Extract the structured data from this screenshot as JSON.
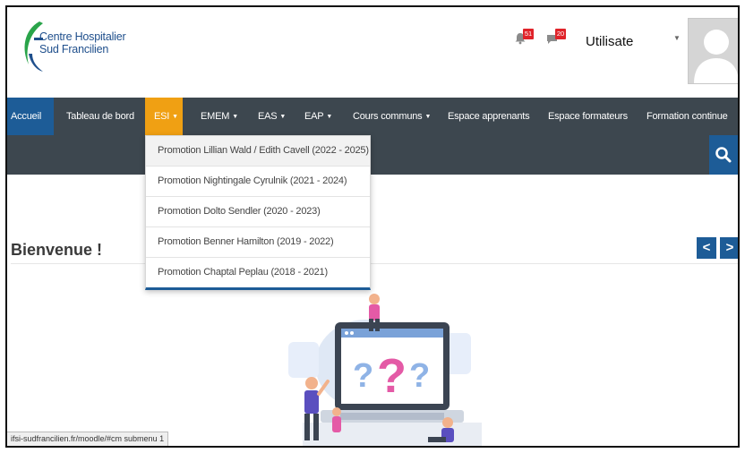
{
  "brand": {
    "line1": "Centre Hospitalier",
    "line2": "Sud Francilien",
    "colors": {
      "green": "#2aa44a",
      "blue": "#1f4f8c"
    }
  },
  "header": {
    "notifications": {
      "icon": "bell-icon",
      "count": "51"
    },
    "messages": {
      "icon": "chat-icon",
      "count": "20"
    },
    "user_name": "Utilisate",
    "user_caret": "▼",
    "avatar_icon": "user-silhouette-icon"
  },
  "nav": {
    "items": [
      {
        "label": "Accueil",
        "state": "active",
        "has_caret": false
      },
      {
        "label": "Tableau de bord",
        "has_caret": false
      },
      {
        "label": "ESI",
        "state": "open",
        "has_caret": true
      },
      {
        "label": "EMEM",
        "has_caret": true
      },
      {
        "label": "EAS",
        "has_caret": true
      },
      {
        "label": "EAP",
        "has_caret": true
      },
      {
        "label": "Cours communs",
        "has_caret": true
      },
      {
        "label": "Espace apprenants",
        "has_caret": false
      },
      {
        "label": "Espace formateurs",
        "has_caret": false
      },
      {
        "label": "Formation continue",
        "has_caret": false
      }
    ],
    "caret": "▼",
    "search_icon": "search-icon"
  },
  "dropdown": {
    "items": [
      "Promotion Lillian Wald / Edith Cavell (2022 - 2025)",
      "Promotion Nightingale Cyrulnik (2021 - 2024)",
      "Promotion Dolto Sendler (2020 - 2023)",
      "Promotion Benner Hamilton (2019 - 2022)",
      "Promotion Chaptal Peplau (2018 - 2021)"
    ]
  },
  "content": {
    "welcome": "Bienvenue !",
    "prev": "<",
    "next": ">"
  },
  "status_bar": {
    "url": "ifsi-sudfrancilien.fr/moodle/#cm submenu 1"
  },
  "colors": {
    "nav_bg": "#3d474f",
    "accent_blue": "#1d5c97",
    "accent_orange": "#f0a013",
    "badge_red": "#e0232a"
  }
}
